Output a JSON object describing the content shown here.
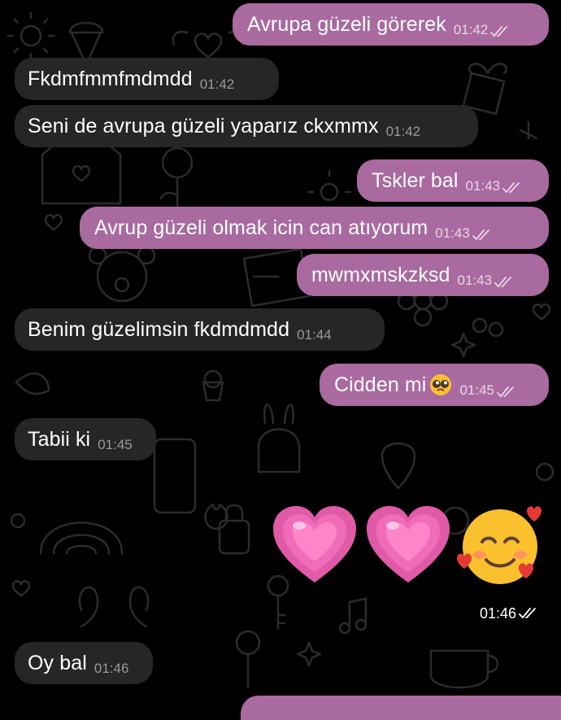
{
  "messages": [
    {
      "text": "Avrupa güzeli görerek",
      "time": "01:42",
      "direction": "out",
      "read": true
    },
    {
      "text": "Fkdmfmmfmdmdd",
      "time": "01:42",
      "direction": "in"
    },
    {
      "text": "Seni de avrupa güzeli yaparız ckxmmx",
      "time": "01:42",
      "direction": "in"
    },
    {
      "text": "Tskler bal",
      "time": "01:43",
      "direction": "out",
      "read": true
    },
    {
      "text": "Avrup güzeli olmak icin can atıyorum",
      "time": "01:43",
      "direction": "out",
      "read": true
    },
    {
      "text": "mwmxmskzksd",
      "time": "01:43",
      "direction": "out",
      "read": true
    },
    {
      "text": "Benim güzelimsin fkdmdmdd",
      "time": "01:44",
      "direction": "in"
    },
    {
      "text": "Cidden mi",
      "emoji": "pleading-face",
      "time": "01:45",
      "direction": "out",
      "read": true
    },
    {
      "text": "Tabii ki",
      "time": "01:45",
      "direction": "in"
    },
    {
      "emojis": [
        "growing-heart",
        "growing-heart",
        "smiling-face-with-hearts"
      ],
      "time": "01:46",
      "direction": "out",
      "read": true
    },
    {
      "text": "Oy bal",
      "time": "01:46",
      "direction": "in"
    }
  ],
  "colors": {
    "background": "#000000",
    "incoming_bubble": "#262628",
    "outgoing_bubble": "#a96aa0",
    "doodle": "#2a2a2a"
  },
  "icons": [
    "double-check-icon",
    "pleading-face-emoji",
    "growing-heart-emoji",
    "smiling-face-with-hearts-emoji"
  ]
}
